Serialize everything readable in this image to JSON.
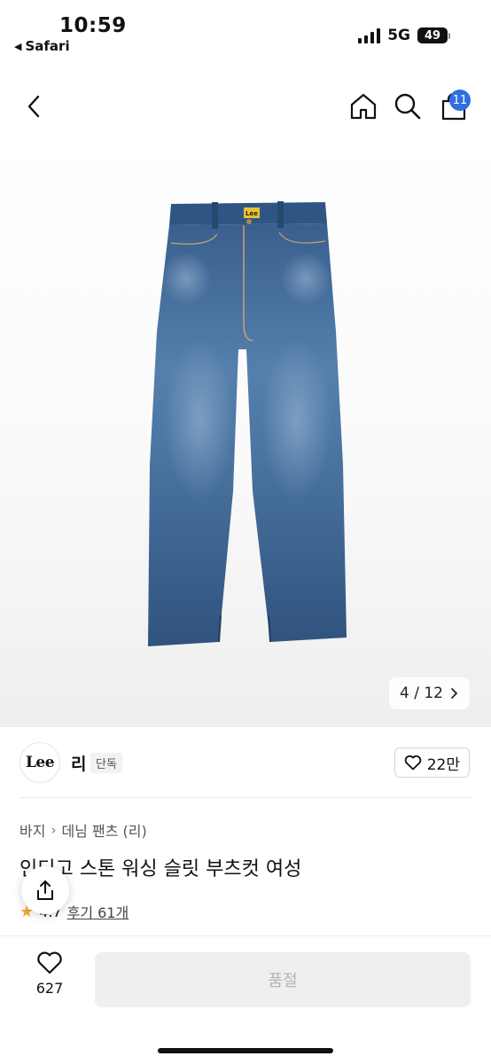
{
  "status_bar": {
    "time": "10:59",
    "back_app": "Safari",
    "network": "5G",
    "battery": "49"
  },
  "header": {
    "back_icon": "chevron-left-icon",
    "home_icon": "home-icon",
    "search_icon": "search-icon",
    "cart_icon": "shopping-bag-icon",
    "cart_count": "11"
  },
  "gallery": {
    "current": "4",
    "total": "12",
    "pager_text": "4 / 12"
  },
  "brand": {
    "logo_text": "Lee",
    "name": "리",
    "tag": "단독",
    "like_count": "22만"
  },
  "breadcrumb": {
    "items": [
      "바지",
      "데님 팬츠 (리)"
    ]
  },
  "product": {
    "title": "인디고 스톤 워싱 슬릿 부츠컷 여성",
    "rating": "4.7",
    "review_text": "후기 61개"
  },
  "bottom_bar": {
    "wish_count": "627",
    "cta_label": "품절"
  },
  "colors": {
    "accent": "#2f6fe4",
    "rating_star": "#f2a92c",
    "soldout_bg": "#efefef",
    "soldout_text": "#b5b5b5"
  }
}
